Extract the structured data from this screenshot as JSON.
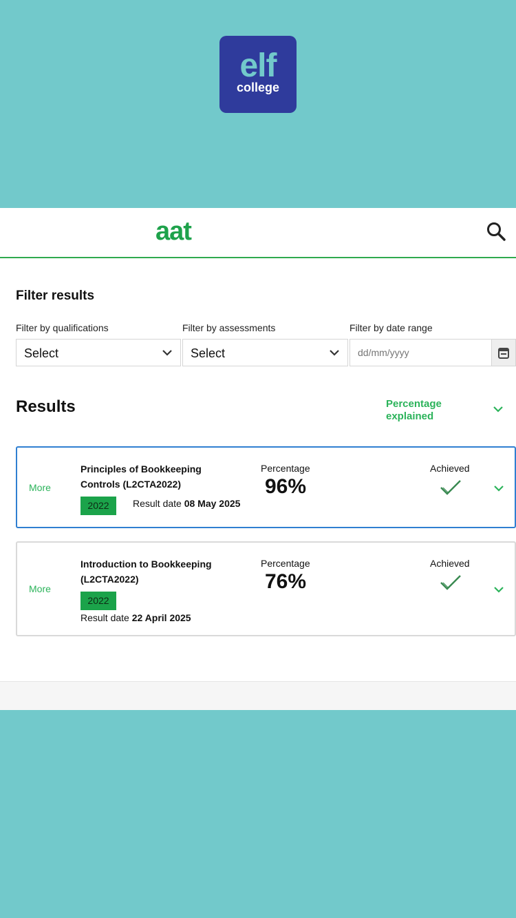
{
  "top_logo": {
    "line1": "elf",
    "line2": "college"
  },
  "header": {
    "logo_text": "aat"
  },
  "filters": {
    "title": "Filter results",
    "qualifications": {
      "label": "Filter by qualifications",
      "value": "Select"
    },
    "assessments": {
      "label": "Filter by assessments",
      "value": "Select"
    },
    "date_range": {
      "label": "Filter by date range",
      "placeholder": "dd/mm/yyyy"
    }
  },
  "results": {
    "title": "Results",
    "percentage_explained": "Percentage explained",
    "items": [
      {
        "more": "More",
        "course": "Principles of Bookkeeping Controls (L2CTA2022)",
        "year": "2022",
        "result_date_label": "Result date",
        "result_date": "08 May 2025",
        "percentage_label": "Percentage",
        "percentage": "96%",
        "status": "Achieved"
      },
      {
        "more": "More",
        "course": "Introduction to Bookkeeping (L2CTA2022)",
        "year": "2022",
        "result_date_label": "Result date",
        "result_date": "22 April 2025",
        "percentage_label": "Percentage",
        "percentage": "76%",
        "status": "Achieved"
      }
    ]
  },
  "colors": {
    "background": "#72c9cb",
    "brand_green": "#1ea24b",
    "link_green": "#2bb35a",
    "active_border": "#2f7fd1",
    "logo_bg": "#2f3b9c"
  }
}
